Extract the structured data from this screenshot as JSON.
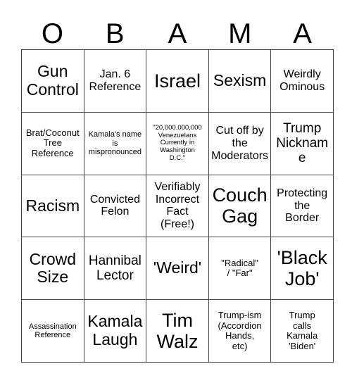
{
  "card": {
    "title_letters": [
      "O",
      "B",
      "A",
      "M",
      "A"
    ],
    "rows": [
      [
        {
          "text": "Gun\nControl",
          "size": "fs-xl"
        },
        {
          "text": "Jan. 6\nReference",
          "size": "fs-m"
        },
        {
          "text": "Israel",
          "size": "fs-xxl"
        },
        {
          "text": "Sexism",
          "size": "fs-xl"
        },
        {
          "text": "Weirdly\nOminous",
          "size": "fs-m"
        }
      ],
      [
        {
          "text": "Brat/Coconut\nTree\nReference",
          "size": "fs-s"
        },
        {
          "text": "Kamala's name\nis\nmispronounced",
          "size": "fs-xs"
        },
        {
          "text": "\"20,000,000,000\nVenezuelans\nCurrently in\nWashington\nD.C.\"",
          "size": "fs-xxs"
        },
        {
          "text": "Cut off by\nthe\nModerators",
          "size": "fs-m"
        },
        {
          "text": "Trump\nNickname",
          "size": "fs-l"
        }
      ],
      [
        {
          "text": "Racism",
          "size": "fs-xl"
        },
        {
          "text": "Convicted\nFelon",
          "size": "fs-m"
        },
        {
          "text": "Verifiably\nIncorrect\nFact\n(Free!)",
          "size": "fs-m"
        },
        {
          "text": "Couch\nGag",
          "size": "fs-xxl"
        },
        {
          "text": "Protecting\nthe\nBorder",
          "size": "fs-m"
        }
      ],
      [
        {
          "text": "Crowd\nSize",
          "size": "fs-xl"
        },
        {
          "text": "Hannibal\nLector",
          "size": "fs-l"
        },
        {
          "text": "'Weird'",
          "size": "fs-xl"
        },
        {
          "text": "\"Radical\"\n/ \"Far\"",
          "size": "fs-s"
        },
        {
          "text": "'Black\nJob'",
          "size": "fs-xxl"
        }
      ],
      [
        {
          "text": "Assassination\nReference",
          "size": "fs-xs"
        },
        {
          "text": "Kamala\nLaugh",
          "size": "fs-xl"
        },
        {
          "text": "Tim\nWalz",
          "size": "fs-xxl"
        },
        {
          "text": "Trump-ism\n(Accordion\nHands,\netc)",
          "size": "fs-s"
        },
        {
          "text": "Trump\ncalls\nKamala\n'Biden'",
          "size": "fs-s"
        }
      ]
    ]
  },
  "colors": {
    "background": "#ffffff",
    "border": "#444444",
    "text": "#000000"
  }
}
